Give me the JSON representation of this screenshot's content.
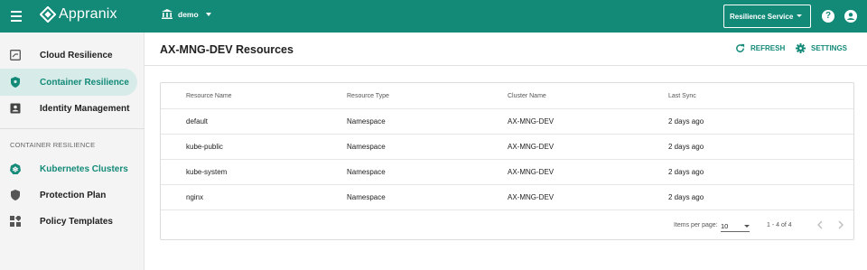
{
  "app": {
    "name": "Appranix"
  },
  "topbar": {
    "tenant": "demo",
    "service_select": "Resilience Service",
    "help_glyph": "?"
  },
  "sidebar": {
    "items": [
      {
        "label": "Cloud Resilience",
        "icon": "cloud-resilience-icon",
        "active": false
      },
      {
        "label": "Container Resilience",
        "icon": "shield-icon",
        "active": true
      },
      {
        "label": "Identity Management",
        "icon": "identity-card-icon",
        "active": false
      }
    ],
    "section_title": "CONTAINER RESILIENCE",
    "section_items": [
      {
        "label": "Kubernetes Clusters",
        "icon": "kubernetes-icon",
        "accent": true
      },
      {
        "label": "Protection Plan",
        "icon": "shield-check-icon",
        "accent": false
      },
      {
        "label": "Policy Templates",
        "icon": "templates-icon",
        "accent": false
      }
    ]
  },
  "page": {
    "title": "AX-MNG-DEV Resources",
    "refresh_label": "REFRESH",
    "settings_label": "SETTINGS"
  },
  "table": {
    "columns": [
      "Resource Name",
      "Resource Type",
      "Cluster Name",
      "Last Sync"
    ],
    "rows": [
      [
        "default",
        "Namespace",
        "AX-MNG-DEV",
        "2 days ago"
      ],
      [
        "kube-public",
        "Namespace",
        "AX-MNG-DEV",
        "2 days ago"
      ],
      [
        "kube-system",
        "Namespace",
        "AX-MNG-DEV",
        "2 days ago"
      ],
      [
        "nginx",
        "Namespace",
        "AX-MNG-DEV",
        "2 days ago"
      ]
    ],
    "paginator": {
      "items_per_page_label": "Items per page:",
      "items_per_page": "10",
      "range": "1 - 4 of 4"
    }
  },
  "colors": {
    "primary": "#138a78",
    "sidebar_active_bg": "#d7ebe8",
    "sidebar_bg": "#f4f4f4"
  }
}
